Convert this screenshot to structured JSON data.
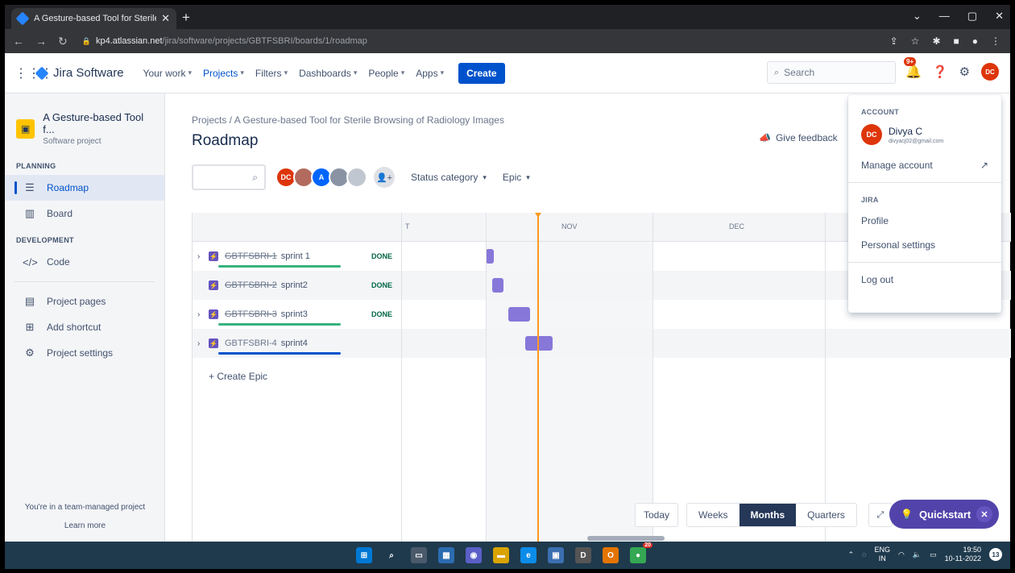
{
  "browser": {
    "tab_title": "A Gesture-based Tool for Sterile B",
    "url_host": "kp4.atlassian.net",
    "url_path": "/jira/software/projects/GBTFSBRI/boards/1/roadmap"
  },
  "topnav": {
    "product": "Jira Software",
    "items": [
      {
        "label": "Your work"
      },
      {
        "label": "Projects"
      },
      {
        "label": "Filters"
      },
      {
        "label": "Dashboards"
      },
      {
        "label": "People"
      },
      {
        "label": "Apps"
      }
    ],
    "create_label": "Create",
    "search_placeholder": "Search",
    "notif_badge": "9+",
    "user_initials": "DC"
  },
  "sidebar": {
    "project_name": "A Gesture-based Tool f...",
    "project_type": "Software project",
    "planning_header": "PLANNING",
    "planning_items": [
      {
        "label": "Roadmap",
        "icon": "roadmap-icon"
      },
      {
        "label": "Board",
        "icon": "board-icon"
      }
    ],
    "development_header": "DEVELOPMENT",
    "development_items": [
      {
        "label": "Code",
        "icon": "code-icon"
      }
    ],
    "other_items": [
      {
        "label": "Project pages",
        "icon": "page-icon"
      },
      {
        "label": "Add shortcut",
        "icon": "add-shortcut-icon"
      },
      {
        "label": "Project settings",
        "icon": "gear-icon"
      }
    ],
    "footer_text": "You're in a team-managed project",
    "learn_more": "Learn more"
  },
  "main": {
    "breadcrumb": "Projects  /  A Gesture-based Tool for Sterile Browsing of Radiology Images",
    "title": "Roadmap",
    "feedback": "Give feedback",
    "avatars": [
      "DC",
      "",
      "A",
      "",
      ""
    ],
    "filters": [
      "Status category",
      "Epic"
    ]
  },
  "timeline": {
    "months": [
      "T",
      "NOV",
      "DEC"
    ],
    "epics": [
      {
        "key": "GBTFSBRI-1",
        "name": "sprint 1",
        "status": "DONE",
        "done": true
      },
      {
        "key": "GBTFSBRI-2",
        "name": "sprint2",
        "status": "DONE",
        "done": true
      },
      {
        "key": "GBTFSBRI-3",
        "name": "sprint3",
        "status": "DONE",
        "done": true
      },
      {
        "key": "GBTFSBRI-4",
        "name": "sprint4",
        "status": "",
        "done": false
      }
    ],
    "create_epic": "+ Create Epic"
  },
  "view": {
    "today": "Today",
    "modes": [
      "Weeks",
      "Months",
      "Quarters"
    ],
    "selected_mode": "Months",
    "quickstart": "Quickstart"
  },
  "account_menu": {
    "account_header": "ACCOUNT",
    "user_name": "Divya C",
    "user_email": "divyacj02@gmail.com",
    "manage_account": "Manage account",
    "jira_header": "JIRA",
    "profile": "Profile",
    "personal_settings": "Personal settings",
    "log_out": "Log out"
  },
  "taskbar": {
    "lang": "ENG",
    "region": "IN",
    "time": "19:50",
    "date": "10-11-2022",
    "chrome_badge": "20",
    "notifications": "13"
  },
  "colors": {
    "brand": "#0052CC",
    "epic_bar": "#8777D9",
    "today_line": "#FF991F",
    "done_green": "#36B37E",
    "avatar_red": "#DE350B",
    "quickstart": "#5243AA"
  }
}
